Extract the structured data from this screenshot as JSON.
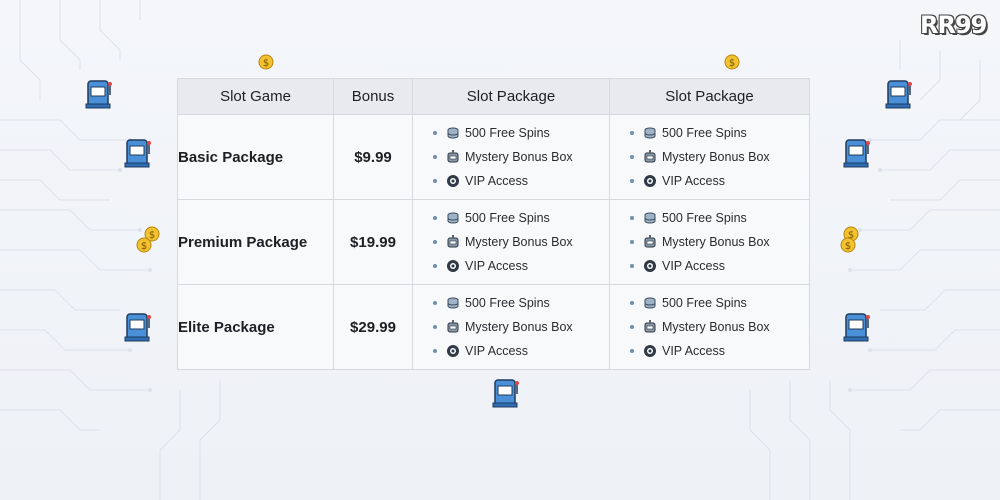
{
  "brand": {
    "logo_text": "RR99"
  },
  "table": {
    "headers": [
      "Slot Game",
      "Bonus",
      "Slot Package",
      "Slot Package"
    ],
    "rows": [
      {
        "name": "Basic Package",
        "price": "$9.99",
        "features_a": [
          "500 Free Spins",
          "Mystery Bonus Box",
          "VIP Access"
        ],
        "features_b": [
          "500 Free Spins",
          "Mystery Bonus Box",
          "VIP Access"
        ]
      },
      {
        "name": "Premium Package",
        "price": "$19.99",
        "features_a": [
          "500 Free Spins",
          "Mystery Bonus Box",
          "VIP Access"
        ],
        "features_b": [
          "500 Free Spins",
          "Mystery Bonus Box",
          "VIP Access"
        ]
      },
      {
        "name": "Elite Package",
        "price": "$29.99",
        "features_a": [
          "500 Free Spins",
          "Mystery Bonus Box",
          "VIP Access"
        ],
        "features_b": [
          "500 Free Spins",
          "Mystery Bonus Box",
          "VIP Access"
        ]
      }
    ]
  },
  "icons": [
    "coin-stack-icon",
    "robot-icon",
    "vip-badge-icon",
    "slot-machine-icon",
    "dollar-coin-icon"
  ],
  "colors": {
    "header_bg": "#e8eaee",
    "border": "#d6d9de",
    "coin": "#f2c230",
    "slot_blue": "#4a90d9"
  }
}
